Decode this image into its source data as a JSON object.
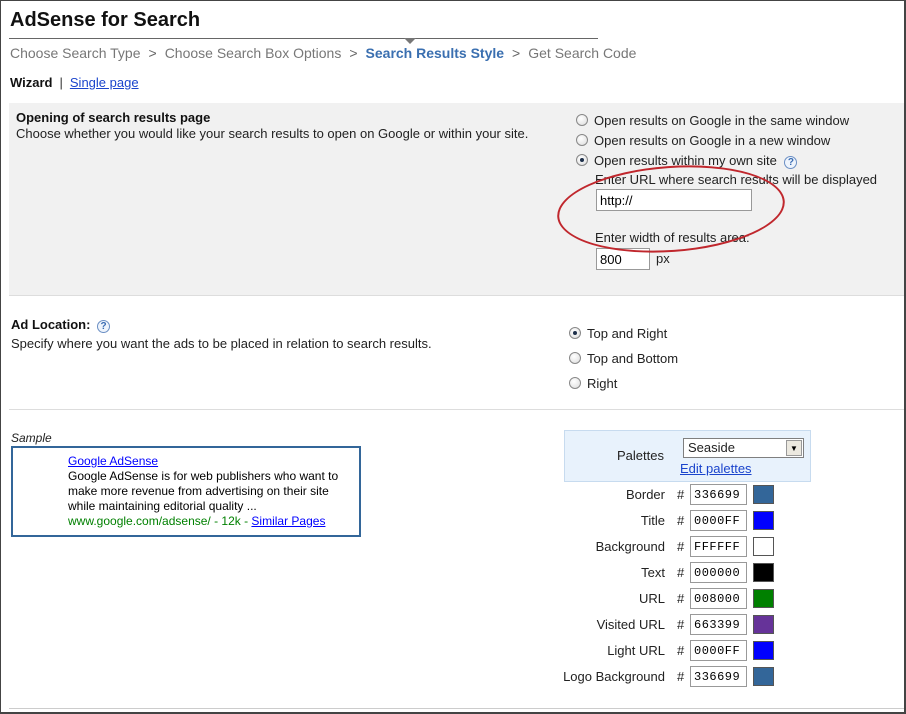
{
  "header": {
    "title": "AdSense for Search",
    "breadcrumbs": [
      {
        "label": "Choose Search Type",
        "current": false
      },
      {
        "label": "Choose Search Box Options",
        "current": false
      },
      {
        "label": "Search Results Style",
        "current": true
      },
      {
        "label": "Get Search Code",
        "current": false
      }
    ],
    "separator": ">",
    "mode": {
      "wizard": "Wizard",
      "divider": "|",
      "single_page": "Single page"
    }
  },
  "opening": {
    "title": "Opening of search results page",
    "description": "Choose whether you would like your search results to open on Google or within your site.",
    "options": [
      {
        "label": "Open results on Google in the same window",
        "selected": false
      },
      {
        "label": "Open results on Google in a new window",
        "selected": false
      },
      {
        "label": "Open results within my own site",
        "selected": true
      }
    ],
    "url_label": "Enter URL where search results will be displayed",
    "url_value": "http://",
    "width_label": "Enter width of results area:",
    "width_value": "800",
    "width_unit": "px",
    "help_glyph": "?"
  },
  "ad_location": {
    "title": "Ad Location:",
    "description": "Specify where you want the ads to be placed in relation to search results.",
    "options": [
      {
        "label": "Top and Right",
        "selected": true
      },
      {
        "label": "Top and Bottom",
        "selected": false
      },
      {
        "label": "Right",
        "selected": false
      }
    ],
    "help_glyph": "?"
  },
  "sample": {
    "heading": "Sample",
    "ad_title": "Google AdSense",
    "ad_text": "Google AdSense is for web publishers who want to make more revenue from advertising on their site while maintaining editorial quality ...",
    "ad_url": "www.google.com/adsense/ - 12k - ",
    "similar_pages": "Similar Pages"
  },
  "palettes": {
    "label": "Palettes",
    "selected": "Seaside",
    "edit_link": "Edit palettes",
    "hash": "#",
    "colors": [
      {
        "label": "Border",
        "hex": "336699",
        "color": "#336699"
      },
      {
        "label": "Title",
        "hex": "0000FF",
        "color": "#0000FF"
      },
      {
        "label": "Background",
        "hex": "FFFFFF",
        "color": "#FFFFFF"
      },
      {
        "label": "Text",
        "hex": "000000",
        "color": "#000000"
      },
      {
        "label": "URL",
        "hex": "008000",
        "color": "#008000"
      },
      {
        "label": "Visited URL",
        "hex": "663399",
        "color": "#663399"
      },
      {
        "label": "Light URL",
        "hex": "0000FF",
        "color": "#0000FF"
      },
      {
        "label": "Logo Background",
        "hex": "336699",
        "color": "#336699"
      }
    ]
  },
  "theme": {
    "accent": "#3a6fb0",
    "link": "#1a0dab",
    "annotation_ring": "#c0272d",
    "section_bg": "#f1f1f1"
  }
}
